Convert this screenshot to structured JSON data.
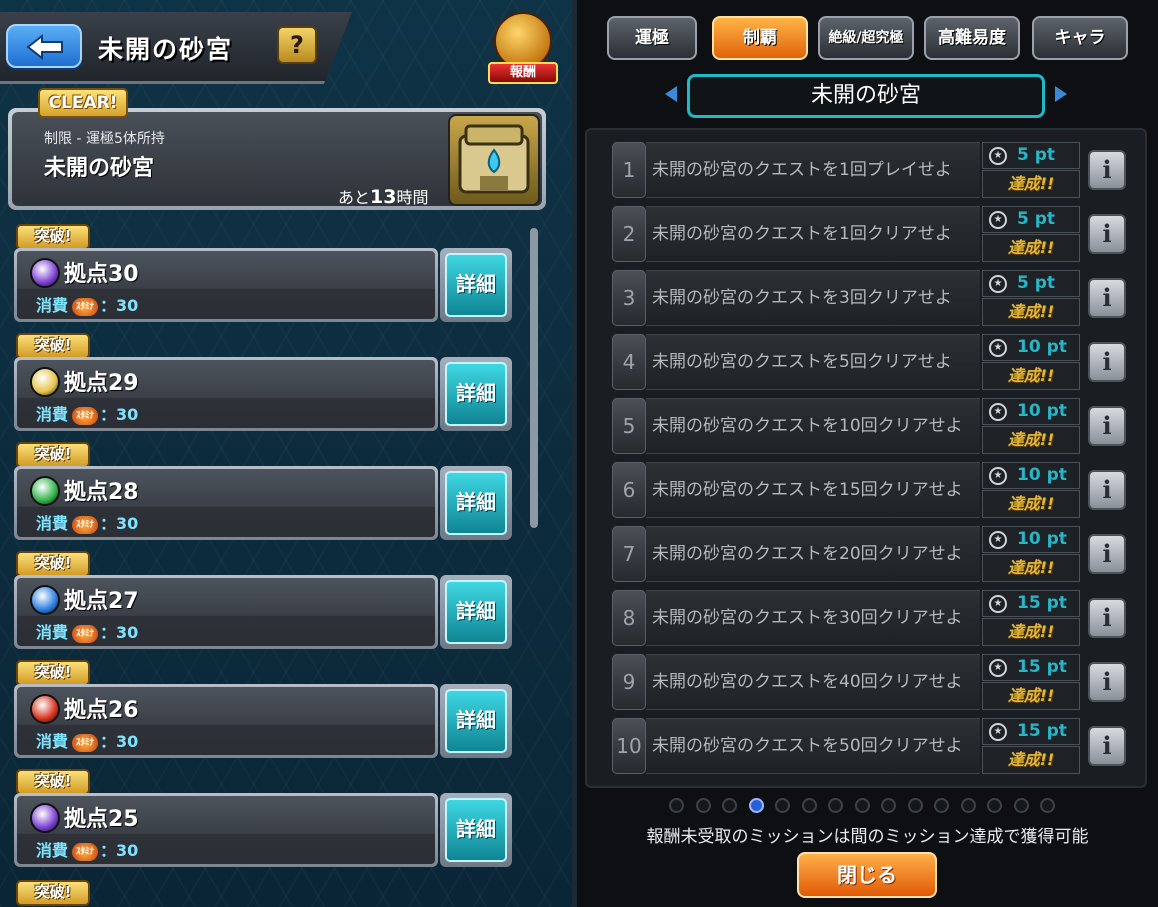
{
  "left": {
    "header_title": "未開の砂宮",
    "help_label": "?",
    "reward_badge_label": "報酬",
    "quest": {
      "clear_badge": "CLEAR!",
      "subtitle": "制限 - 運極5体所持",
      "name": "未開の砂宮",
      "time_prefix": "あと",
      "time_value": "13",
      "time_unit": "時間"
    },
    "breach_label": "突破!",
    "cost_label": "消費",
    "stamina_label": "ｽﾀﾐﾅ",
    "detail_label": "詳細",
    "stages": [
      {
        "name": "拠点30",
        "cost": "：30",
        "element": "dark",
        "color": "#7a3fd1"
      },
      {
        "name": "拠点29",
        "cost": "：30",
        "element": "light",
        "color": "#e6c44a"
      },
      {
        "name": "拠点28",
        "cost": "：30",
        "element": "wood",
        "color": "#2fb34a"
      },
      {
        "name": "拠点27",
        "cost": "：30",
        "element": "water",
        "color": "#2a7fe0"
      },
      {
        "name": "拠点26",
        "cost": "：30",
        "element": "fire",
        "color": "#d8321e"
      },
      {
        "name": "拠点25",
        "cost": "：30",
        "element": "dark",
        "color": "#7a3fd1"
      }
    ]
  },
  "right": {
    "tabs": [
      {
        "label": "運極",
        "active": false
      },
      {
        "label": "制覇",
        "active": true
      },
      {
        "label": "絶級/超究極",
        "active": false
      },
      {
        "label": "高難易度",
        "active": false
      },
      {
        "label": "キャラ",
        "active": false
      }
    ],
    "title": "未開の砂宮",
    "achieved_label": "達成!!",
    "info_label": "i",
    "missions": [
      {
        "num": "1",
        "text": "未開の砂宮のクエストを1回プレイせよ",
        "pt": "5 pt"
      },
      {
        "num": "2",
        "text": "未開の砂宮のクエストを1回クリアせよ",
        "pt": "5 pt"
      },
      {
        "num": "3",
        "text": "未開の砂宮のクエストを3回クリアせよ",
        "pt": "5 pt"
      },
      {
        "num": "4",
        "text": "未開の砂宮のクエストを5回クリアせよ",
        "pt": "10 pt"
      },
      {
        "num": "5",
        "text": "未開の砂宮のクエストを10回クリアせよ",
        "pt": "10 pt"
      },
      {
        "num": "6",
        "text": "未開の砂宮のクエストを15回クリアせよ",
        "pt": "10 pt"
      },
      {
        "num": "7",
        "text": "未開の砂宮のクエストを20回クリアせよ",
        "pt": "10 pt"
      },
      {
        "num": "8",
        "text": "未開の砂宮のクエストを30回クリアせよ",
        "pt": "15 pt"
      },
      {
        "num": "9",
        "text": "未開の砂宮のクエストを40回クリアせよ",
        "pt": "15 pt"
      },
      {
        "num": "10",
        "text": "未開の砂宮のクエストを50回クリアせよ",
        "pt": "15 pt"
      }
    ],
    "page_count": 15,
    "current_page": 4,
    "note": "報酬未受取のミッションは間のミッション達成で獲得可能",
    "close_label": "閉じる"
  }
}
